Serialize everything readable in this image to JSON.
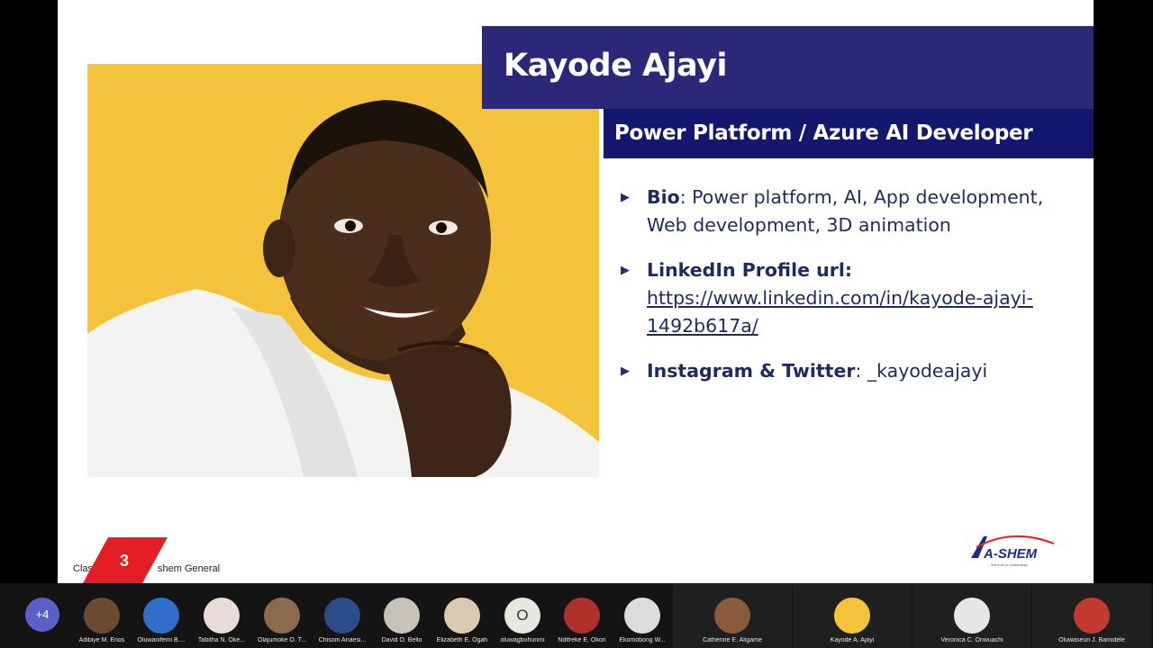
{
  "slide": {
    "title": "Kayode Ajayi",
    "subtitle": "Power Platform / Azure AI Developer",
    "bullets": [
      {
        "label": "Bio",
        "text": ": Power platform, AI, App development, Web development, 3D animation"
      },
      {
        "label": "LinkedIn Profile url:",
        "link": "https://www.linkedin.com/in/kayode-ajayi-1492b617a/"
      },
      {
        "label": "Instagram & Twitter",
        "text": ": _kayodeajayi"
      }
    ],
    "footer_left": "Clas",
    "footer_right": "shem General",
    "slide_number": "3",
    "logo_text": "A-SHEM",
    "logo_tagline": "... the trust in relationship"
  },
  "participants": {
    "overflow_label": "+4",
    "small": [
      {
        "name": "Adibiye M. Enos"
      },
      {
        "name": "Oluwanifemi B...."
      },
      {
        "name": "Tabitha N. Oke..."
      },
      {
        "name": "Olajumoke O. T..."
      },
      {
        "name": "Chisom Anaesi..."
      },
      {
        "name": "David O. Bello"
      },
      {
        "name": "Elizabeth E. Ogah"
      },
      {
        "name": "oluwagbohunmi",
        "initial": "O"
      },
      {
        "name": "Ndifreke E. Okon"
      },
      {
        "name": "Ekomobong W..."
      }
    ],
    "large": [
      {
        "name": "Catherine E. Aligame"
      },
      {
        "name": "Kayode A. Ajayi"
      },
      {
        "name": "Veronica C. Onwuachi"
      },
      {
        "name": "Oluwaseun J. Bamidele"
      }
    ]
  },
  "colors": {
    "title_bar": "#2b2879",
    "subtitle_bar": "#13176d",
    "photo_background": "#f5c33b",
    "accent_red": "#e31e24"
  }
}
